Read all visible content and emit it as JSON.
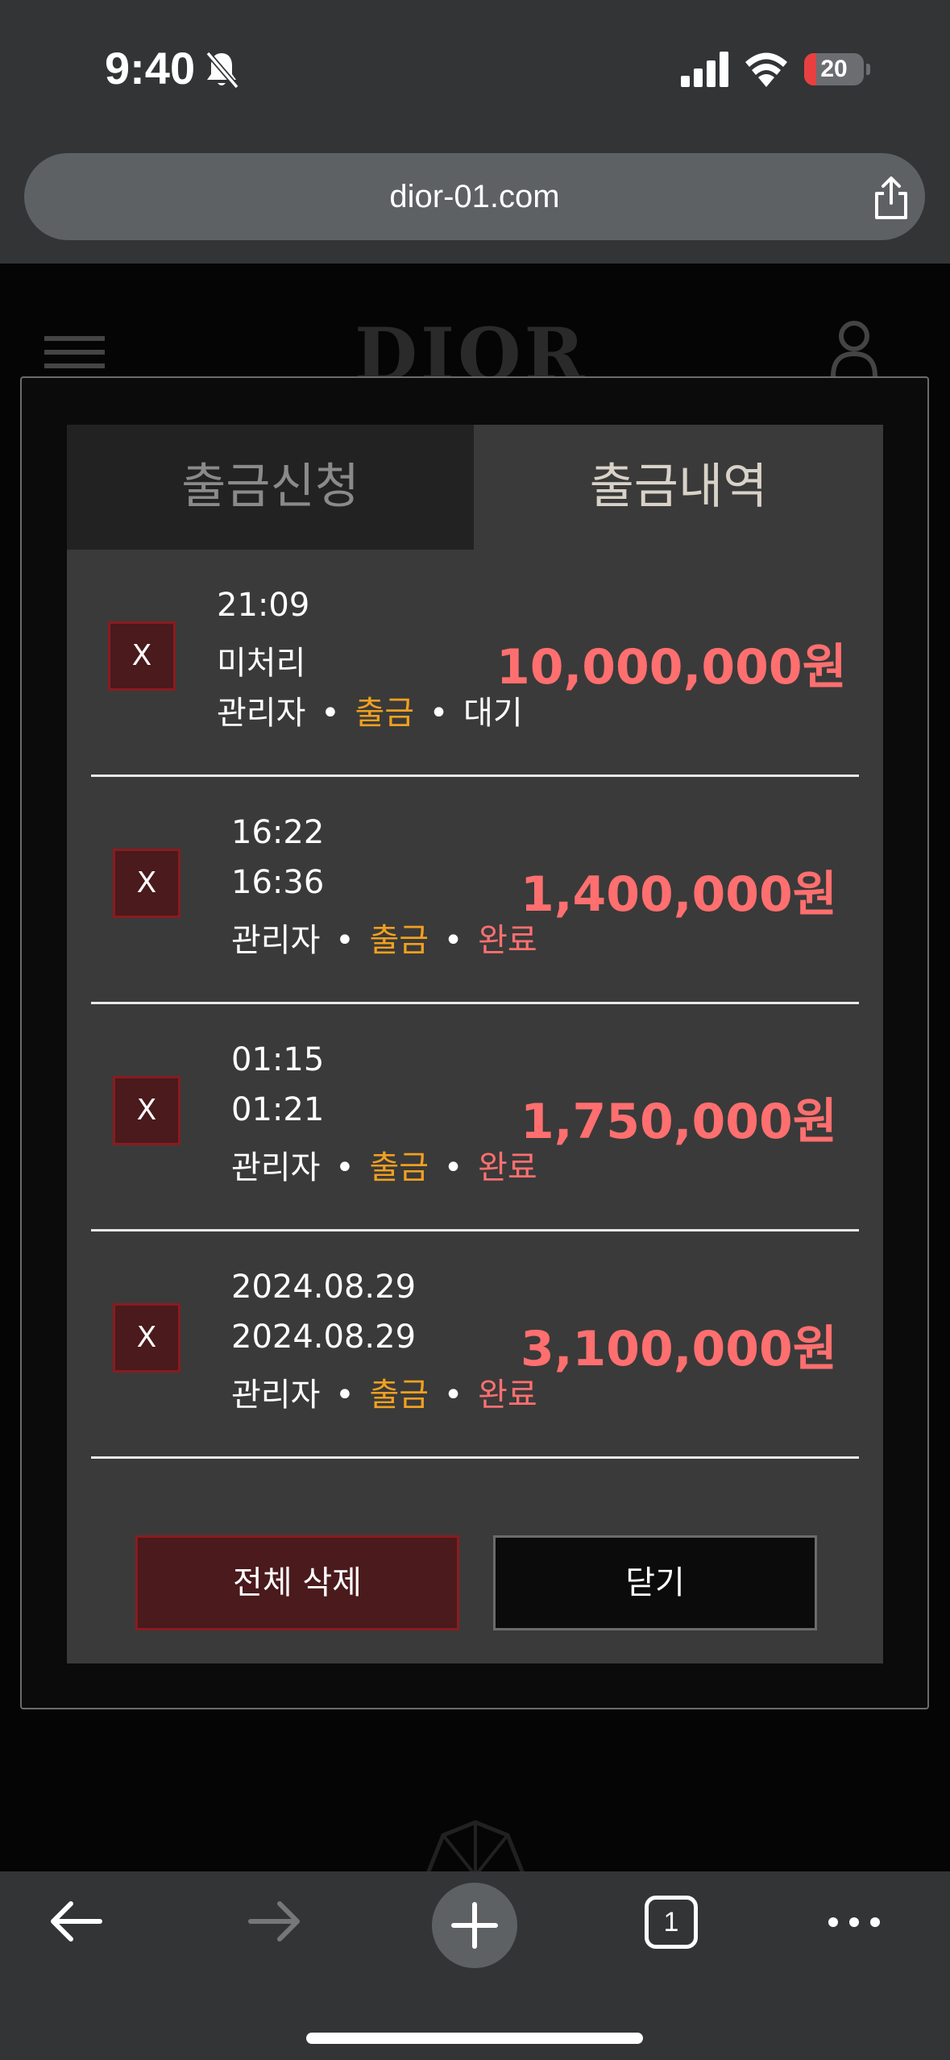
{
  "status_bar": {
    "time": "9:40",
    "battery": "20",
    "battery_level_percent": 20
  },
  "browser": {
    "url": "dior-01.com",
    "tab_count": "1"
  },
  "background_site": {
    "logo": "DIOR"
  },
  "modal": {
    "tabs": [
      {
        "label": "출금신청",
        "active": false
      },
      {
        "label": "출금내역",
        "active": true
      }
    ],
    "records": [
      {
        "delete_label": "X",
        "line1": "21:09",
        "line2": "미처리",
        "actor": "관리자",
        "dot1": "•",
        "type": "출금",
        "dot2": "•",
        "status": "대기",
        "status_kind": "wait",
        "amount": "10,000,000원"
      },
      {
        "delete_label": "X",
        "line1": "16:22",
        "line2": "16:36",
        "actor": "관리자",
        "dot1": "•",
        "type": "출금",
        "dot2": "•",
        "status": "완료",
        "status_kind": "done",
        "amount": "1,400,000원"
      },
      {
        "delete_label": "X",
        "line1": "01:15",
        "line2": "01:21",
        "actor": "관리자",
        "dot1": "•",
        "type": "출금",
        "dot2": "•",
        "status": "완료",
        "status_kind": "done",
        "amount": "1,750,000원"
      },
      {
        "delete_label": "X",
        "line1": "2024.08.29",
        "line2": "2024.08.29",
        "actor": "관리자",
        "dot1": "•",
        "type": "출금",
        "dot2": "•",
        "status": "완료",
        "status_kind": "done",
        "amount": "3,100,000원"
      }
    ],
    "buttons": {
      "delete_all": "전체 삭제",
      "close": "닫기"
    }
  },
  "colors": {
    "amount": "#ff6f6f",
    "type_label": "#f0a020",
    "status_done": "#ff7070",
    "delete_bg": "#4a1a1c",
    "delete_border": "#8a1b1f"
  },
  "icons": [
    "bell-muted-icon",
    "signal-icon",
    "wifi-icon",
    "battery-icon",
    "share-icon",
    "back-icon",
    "forward-icon",
    "plus-icon",
    "more-icon"
  ]
}
